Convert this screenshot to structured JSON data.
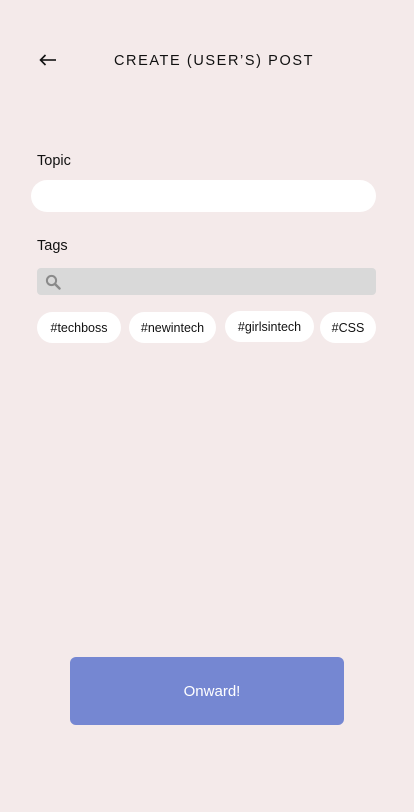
{
  "header": {
    "title": "CREATE (USER’S) POST",
    "back_icon": "arrow-left-icon"
  },
  "form": {
    "topic_label": "Topic",
    "topic_value": "",
    "tags_label": "Tags",
    "tags_search_value": "",
    "search_icon": "search-icon"
  },
  "tags": [
    {
      "label": "#techboss"
    },
    {
      "label": "#newintech"
    },
    {
      "label": "#girlsintech"
    },
    {
      "label": "#CSS"
    }
  ],
  "actions": {
    "submit_label": "Onward!"
  },
  "colors": {
    "background": "#f4eaea",
    "field": "#ffffff",
    "search_field": "#d9d9d9",
    "primary_button": "#7587d2"
  }
}
